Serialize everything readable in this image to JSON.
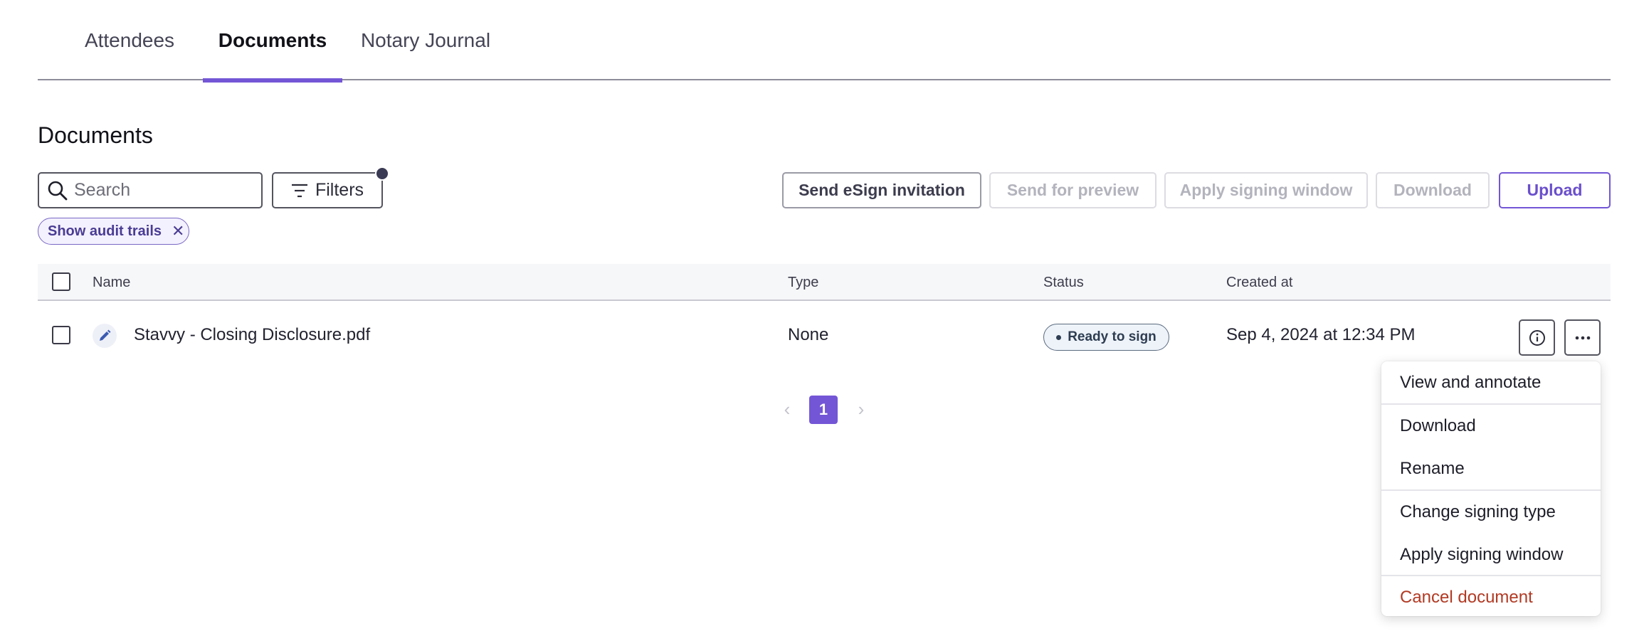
{
  "tabs": [
    {
      "label": "Attendees"
    },
    {
      "label": "Documents"
    },
    {
      "label": "Notary Journal"
    }
  ],
  "section_title": "Documents",
  "search": {
    "placeholder": "Search",
    "value": ""
  },
  "filters_label": "Filters",
  "actions": {
    "send_esign": "Send eSign invitation",
    "send_preview": "Send for preview",
    "apply_window": "Apply signing window",
    "download": "Download",
    "upload": "Upload"
  },
  "chip": {
    "label": "Show audit trails",
    "close": "✕"
  },
  "table": {
    "columns": {
      "name": "Name",
      "type": "Type",
      "status": "Status",
      "created": "Created at"
    },
    "rows": [
      {
        "name": "Stavvy - Closing Disclosure.pdf",
        "type": "None",
        "status": "Ready to sign",
        "created": "Sep 4, 2024 at 12:34 PM"
      }
    ]
  },
  "pagination": {
    "current": "1",
    "prev": "‹",
    "next": "›"
  },
  "menu": [
    {
      "label": "View and annotate"
    },
    {
      "label": "Download"
    },
    {
      "label": "Rename"
    },
    {
      "label": "Change signing type"
    },
    {
      "label": "Apply signing window"
    },
    {
      "label": "Cancel document"
    }
  ],
  "colors": {
    "accent": "#7356d6",
    "danger": "#b23a23",
    "status_border": "#5b6b80"
  },
  "icons": [
    "search-icon",
    "filter-icon",
    "close-icon",
    "pencil-icon",
    "info-icon",
    "more-icon",
    "chevron-left-icon",
    "chevron-right-icon"
  ]
}
